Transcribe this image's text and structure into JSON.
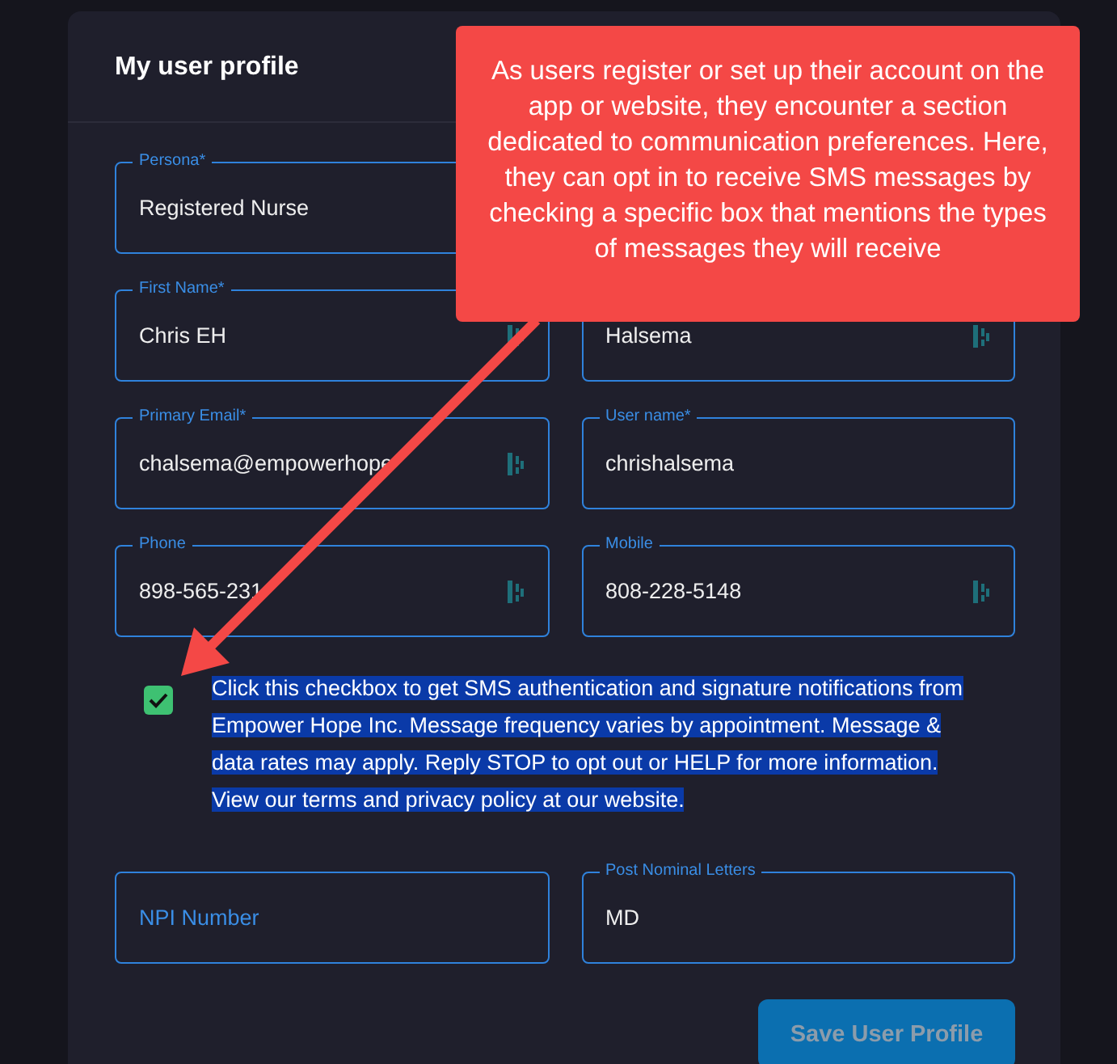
{
  "title": "My user profile",
  "rows": [
    [
      {
        "label": "Persona*",
        "value": "Registered Nurse",
        "autofill_icon": false
      }
    ],
    [
      {
        "label": "First Name*",
        "value": "Chris EH",
        "autofill_icon": true
      },
      {
        "value": "Halsema",
        "autofill_icon": true
      }
    ],
    [
      {
        "label": "Primary Email*",
        "value": "chalsema@empowerhope",
        "autofill_icon": true
      },
      {
        "label": "User name*",
        "value": "chrishalsema",
        "autofill_icon": false
      }
    ],
    [
      {
        "label": "Phone",
        "value": "898-565-231",
        "autofill_icon": true
      },
      {
        "label": "Mobile",
        "value": "808-228-5148",
        "autofill_icon": true
      }
    ]
  ],
  "consent": {
    "checked": true,
    "text_selected": true,
    "text": "Click this checkbox to get SMS authentication and signature notifications from Empower Hope Inc. Message frequency varies by appointment. Message & data rates may apply. Reply STOP to opt out or HELP for more information. View our terms and privacy policy at our website."
  },
  "rows_after": [
    [
      {
        "placeholder": "NPI Number",
        "autofill_icon": false
      },
      {
        "label": "Post Nominal Letters",
        "value": "MD",
        "autofill_icon": false
      }
    ]
  ],
  "save_button": {
    "label": "Save User Profile",
    "disabled": true
  },
  "callout": {
    "text": "As users register or set up their account on the app or website, they encounter a section dedicated to communication preferences. Here, they can opt in to receive SMS messages by checking a specific box that mentions the types of messages they will receive"
  }
}
